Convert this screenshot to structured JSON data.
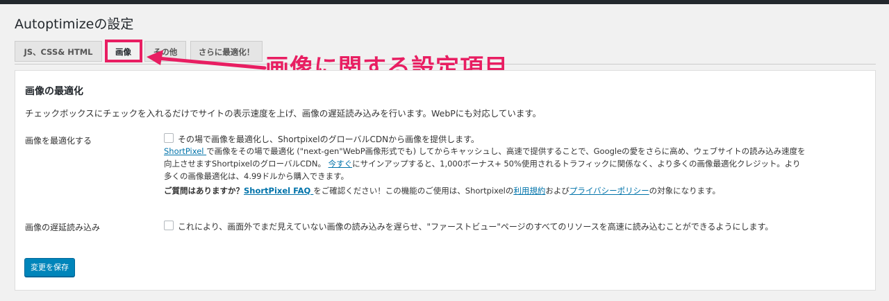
{
  "page": {
    "title": "Autoptimizeの設定"
  },
  "tabs": [
    {
      "label": "JS、CSS& HTML"
    },
    {
      "label": "画像"
    },
    {
      "label": "その他"
    },
    {
      "label": "さらに最適化！"
    }
  ],
  "annotation": {
    "text": "画像に関する設定項目",
    "color": "#e81e62"
  },
  "section": {
    "title": "画像の最適化",
    "description": "チェックボックスにチェックを入れるだけでサイトの表示速度を上げ、画像の遅延読み込みを行います。WebPにも対応しています。"
  },
  "optimize_row": {
    "label": "画像を最適化する",
    "checkbox_text": "その場で画像を最適化し、ShortpixelのグローバルCDNから画像を提供します。",
    "info": {
      "link_shortpixel": "ShortPixel ",
      "line1_rest": "で画像をその場で最適化 (\"next-gen\"WebP画像形式でも) してからキャッシュし、高速で提供することで、Googleの愛をさらに高め、ウェブサイトの読み込み速度を",
      "line2_start": "向上させますShortpixelのグローバルCDN。",
      "link_now": "今すぐ",
      "line2_rest": "にサインアップすると、1,000ボーナス+ 50%使用されるトラフィックに関係なく、より多くの画像最適化クレジット。より",
      "line3": "多くの画像最適化は、4.99ドルから購入できます。",
      "faq_bold": "ご質問はありますか？",
      "link_faq": "ShortPixel FAQ ",
      "faq_mid": "をご確認ください！この機能のご使用は、Shortpixelの",
      "link_terms": "利用規約",
      "faq_and": "および",
      "link_privacy": "プライバシーポリシー",
      "faq_end": "の対象になります。"
    }
  },
  "lazyload_row": {
    "label": "画像の遅延読み込み",
    "checkbox_text": "これにより、画面外でまだ見えていない画像の読み込みを遅らせ、\"ファーストビュー\"ページのすべてのリソースを高速に読み込むことができるようにします。"
  },
  "save_button": {
    "label": "変更を保存"
  }
}
